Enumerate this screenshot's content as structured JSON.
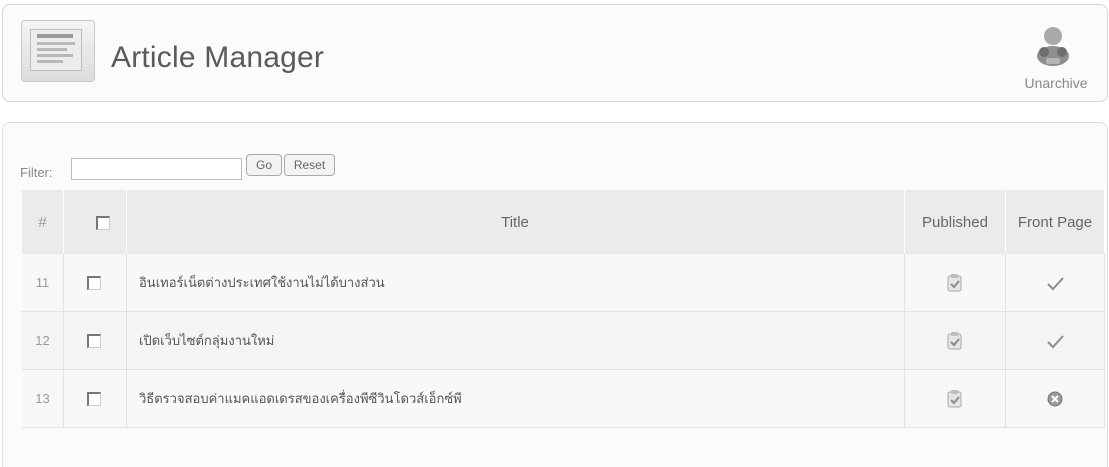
{
  "header": {
    "title": "Article Manager",
    "icon": "article-manager-icon",
    "toolbar": {
      "unarchive_label": "Unarchive",
      "unarchive_icon": "unarchive-icon"
    }
  },
  "filter": {
    "label": "Filter:",
    "value": "",
    "placeholder": "",
    "go_label": "Go",
    "reset_label": "Reset"
  },
  "table": {
    "columns": {
      "number": "#",
      "title": "Title",
      "published": "Published",
      "front_page": "Front Page"
    },
    "rows": [
      {
        "number": "11",
        "title": "อินเทอร์เน็ตต่างประเทศใช้งานไม่ได้บางส่วน",
        "published": "published-icon",
        "front_page": "check-icon"
      },
      {
        "number": "12",
        "title": "เปิดเว็บไซต์กลุ่มงานใหม่",
        "published": "published-icon",
        "front_page": "check-icon"
      },
      {
        "number": "13",
        "title": "วิธีตรวจสอบค่าแมคแอดเดรสของเครื่องพีซีวินโดวส์เอ็กซ์พี",
        "published": "published-icon",
        "front_page": "not-front-page-icon"
      }
    ]
  },
  "colors": {
    "header_bg": "#ebebeb",
    "panel_border": "#d6d6d6",
    "text": "#555555"
  }
}
